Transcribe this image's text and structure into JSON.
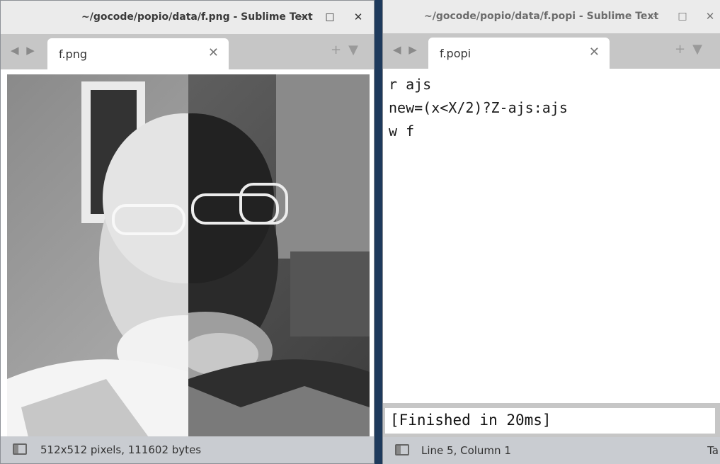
{
  "left_window": {
    "title": "~/gocode/popio/data/f.png - Sublime Text",
    "controls": {
      "minimize": "–",
      "maximize": "□",
      "close": "✕"
    },
    "nav": "◀ ▶",
    "tab": {
      "label": "f.png",
      "close": "✕"
    },
    "tools": "+▼",
    "status": "512x512 pixels, 111602 bytes"
  },
  "right_window": {
    "title": "~/gocode/popio/data/f.popi - Sublime Text",
    "controls": {
      "minimize": "–",
      "maximize": "□",
      "close": "✕"
    },
    "nav": "◀ ▶",
    "tab": {
      "label": "f.popi",
      "close": "✕"
    },
    "tools": "+▼",
    "code": [
      "r ajs",
      "new=(x<X/2)?Z-ajs:ajs",
      "w f"
    ],
    "output": "[Finished in 20ms]",
    "status": "Line 5, Column 1",
    "status_right": "Ta"
  }
}
